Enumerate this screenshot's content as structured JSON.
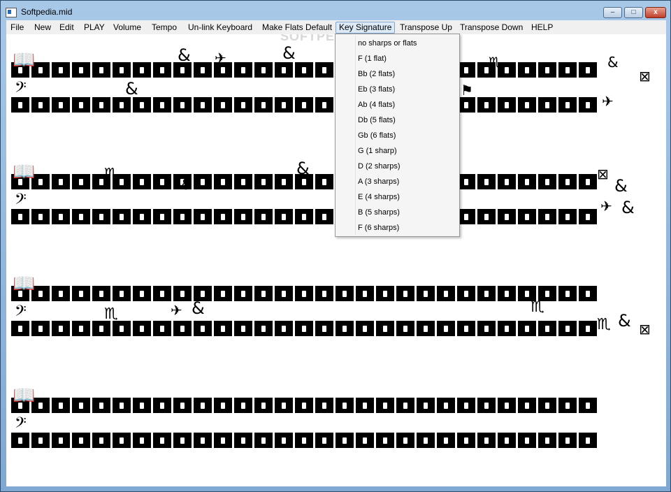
{
  "window": {
    "title": "Softpedia.mid",
    "icon": "app-icon",
    "controls": {
      "minimize": "–",
      "maximize": "□",
      "close": "x"
    }
  },
  "menubar": {
    "items": [
      {
        "label": "File"
      },
      {
        "label": "New"
      },
      {
        "label": "Edit"
      },
      {
        "label": "PLAY"
      },
      {
        "label": "Volume"
      },
      {
        "label": "Tempo"
      },
      {
        "label": "Un-link Keyboard"
      },
      {
        "label": "Make Flats Default"
      },
      {
        "label": "Key Signature"
      },
      {
        "label": "Transpose Up"
      },
      {
        "label": "Transpose Down"
      },
      {
        "label": "HELP"
      }
    ],
    "active": "Key Signature"
  },
  "key_signature_menu": {
    "items": [
      "no sharps or flats",
      "F (1 flat)",
      "Bb (2 flats)",
      "Eb (3 flats)",
      "Ab (4 flats)",
      "Db (5 flats)",
      "Gb (6 flats)",
      "G (1 sharp)",
      "D (2 sharps)",
      "A (3 sharps)",
      "E (4 sharps)",
      "B (5 sharps)",
      "F (6 sharps)"
    ]
  },
  "watermark": "SOFTPEDIA",
  "colors": {
    "accent": "#dce9f6",
    "menu_bg": "#f0f0f0",
    "canvas_bg": "#ffffff"
  }
}
